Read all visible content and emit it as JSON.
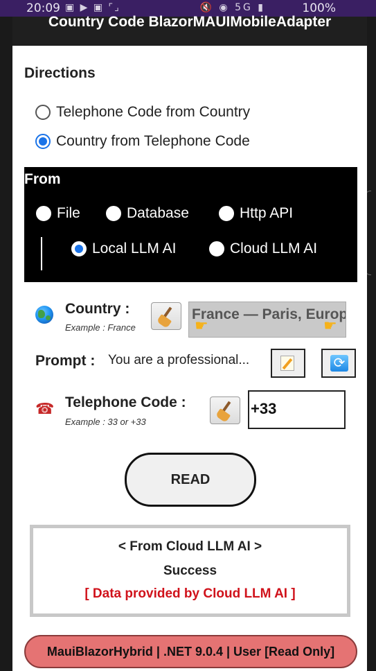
{
  "status_bar": {
    "time": "20:09",
    "left_icons": "▣ ▶ ▣ ⌜⌟",
    "right_icons": "🔇 ◉ 5G ▮",
    "battery": "100%"
  },
  "header": {
    "title": "Country Code BlazorMAUIMobileAdapter"
  },
  "directions": {
    "title": "Directions",
    "options": [
      {
        "label": "Telephone Code from Country",
        "selected": false
      },
      {
        "label": "Country from Telephone Code",
        "selected": true
      }
    ]
  },
  "from": {
    "title": "From",
    "row1": [
      {
        "label": "File",
        "selected": false
      },
      {
        "label": "Database",
        "selected": false
      },
      {
        "label": "Http API",
        "selected": false
      }
    ],
    "row2": [
      {
        "label": "Local LLM AI",
        "selected": true
      },
      {
        "label": "Cloud LLM AI",
        "selected": false
      }
    ]
  },
  "country": {
    "label": "Country :",
    "example": "Example : France",
    "value": "France — Paris, Europe",
    "icon": "globe-icon"
  },
  "prompt": {
    "label": "Prompt :",
    "value": "You are a professional..."
  },
  "telephone": {
    "label": "Telephone Code :",
    "example": "Example : 33 or +33",
    "value": "+33",
    "icon": "telephone-icon"
  },
  "read_button": {
    "label": "READ"
  },
  "result": {
    "line1": "< From Cloud LLM AI >",
    "line2": "Success",
    "line3": "[ Data provided by Cloud LLM AI ]"
  },
  "footer": {
    "text": "MauiBlazorHybrid | .NET 9.0.4 | User [Read Only]"
  },
  "colors": {
    "accent": "#1a73e8",
    "footer_bg": "#e57373",
    "result_highlight": "#d0121b"
  }
}
